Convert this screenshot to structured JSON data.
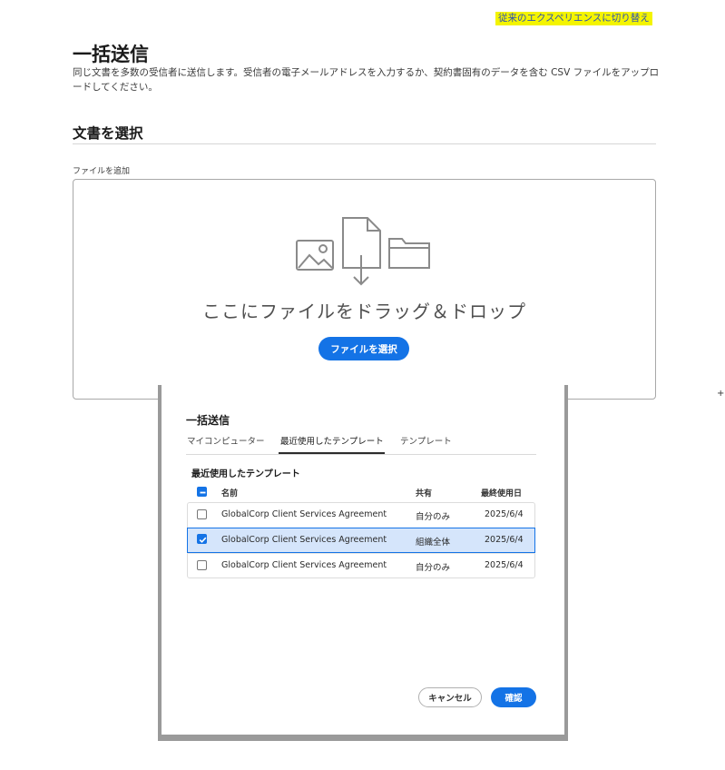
{
  "header": {
    "legacy_link": "従来のエクスペリエンスに切り替え",
    "title": "一括送信",
    "description": "同じ文書を多数の受信者に送信します。受信者の電子メールアドレスを入力するか、契約書固有のデータを含む CSV ファイルをアップロードしてください。"
  },
  "section": {
    "title": "文書を選択",
    "add_files_label": "ファイルを追加"
  },
  "dropzone": {
    "text": "ここにファイルをドラッグ＆ドロップ",
    "select_button": "ファイルを選択"
  },
  "stray_mark": "+",
  "dialog": {
    "title": "一括送信",
    "tabs": [
      {
        "label": "マイコンピューター"
      },
      {
        "label": "最近使用したテンプレート"
      },
      {
        "label": "テンプレート"
      }
    ],
    "list_heading": "最近使用したテンプレート",
    "columns": {
      "name": "名前",
      "shared": "共有",
      "last_used": "最終使用日"
    },
    "rows": [
      {
        "name": "GlobalCorp Client Services Agreement",
        "shared": "自分のみ",
        "last_used": "2025/6/4",
        "checked": false
      },
      {
        "name": "GlobalCorp Client Services Agreement",
        "shared": "組織全体",
        "last_used": "2025/6/4",
        "checked": true
      },
      {
        "name": "GlobalCorp Client Services Agreement",
        "shared": "自分のみ",
        "last_used": "2025/6/4",
        "checked": false
      }
    ],
    "cancel_button": "キャンセル",
    "confirm_button": "確認"
  },
  "colors": {
    "accent": "#1473e6",
    "highlight": "#f4f400",
    "selected_row": "#d5e5fb"
  }
}
